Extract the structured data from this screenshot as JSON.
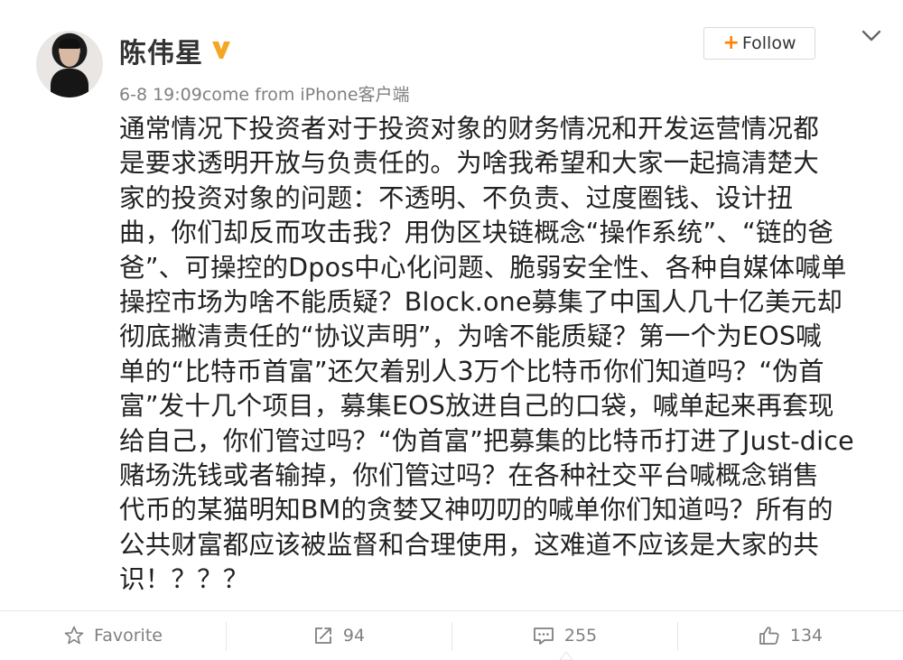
{
  "user": {
    "name": "陈伟星",
    "verified_badge": "V"
  },
  "post": {
    "timestamp": "6-8 19:09",
    "source": "come from iPhone客户端",
    "text": "通常情况下投资者对于投资对象的财务情况和开发运营情况都\n是要求透明开放与负责任的。为啥我希望和大家一起搞清楚大\n家的投资对象的问题：不透明、不负责、过度圈钱、设计扭\n曲，你们却反而攻击我？用伪区块链概念“操作系统”、“链的爸\n爸”、可操控的Dpos中心化问题、脆弱安全性、各种自媒体喊单\n操控市场为啥不能质疑？Block.one募集了中国人几十亿美元却\n彻底撇清责任的“协议声明”，为啥不能质疑？第一个为EOS喊\n单的“比特币首富”还欠着别人3万个比特币你们知道吗？“伪首\n富”发十几个项目，募集EOS放进自己的口袋，喊单起来再套现\n给自己，你们管过吗？“伪首富”把募集的比特币打进了Just-dice\n赌场洗钱或者输掉，你们管过吗？在各种社交平台喊概念销售\n代币的某猫明知BM的贪婪又神叨叨的喊单你们知道吗？所有的\n公共财富都应该被监督和合理使用，这难道不应该是大家的共\n识！？？？"
  },
  "header": {
    "follow_plus": "+",
    "follow_label": "Follow"
  },
  "footer": {
    "favorite_label": "Favorite",
    "repost_count": "94",
    "comment_count": "255",
    "like_count": "134"
  },
  "colors": {
    "accent": "#ff8200",
    "verified": "#f5a623",
    "text": "#222222",
    "muted": "#808080"
  },
  "icons": {
    "verified": "verified-badge-icon",
    "menu": "chevron-down-icon",
    "favorite": "star-icon",
    "repost": "repost-icon",
    "comment": "comment-icon",
    "like": "thumbs-up-icon"
  }
}
